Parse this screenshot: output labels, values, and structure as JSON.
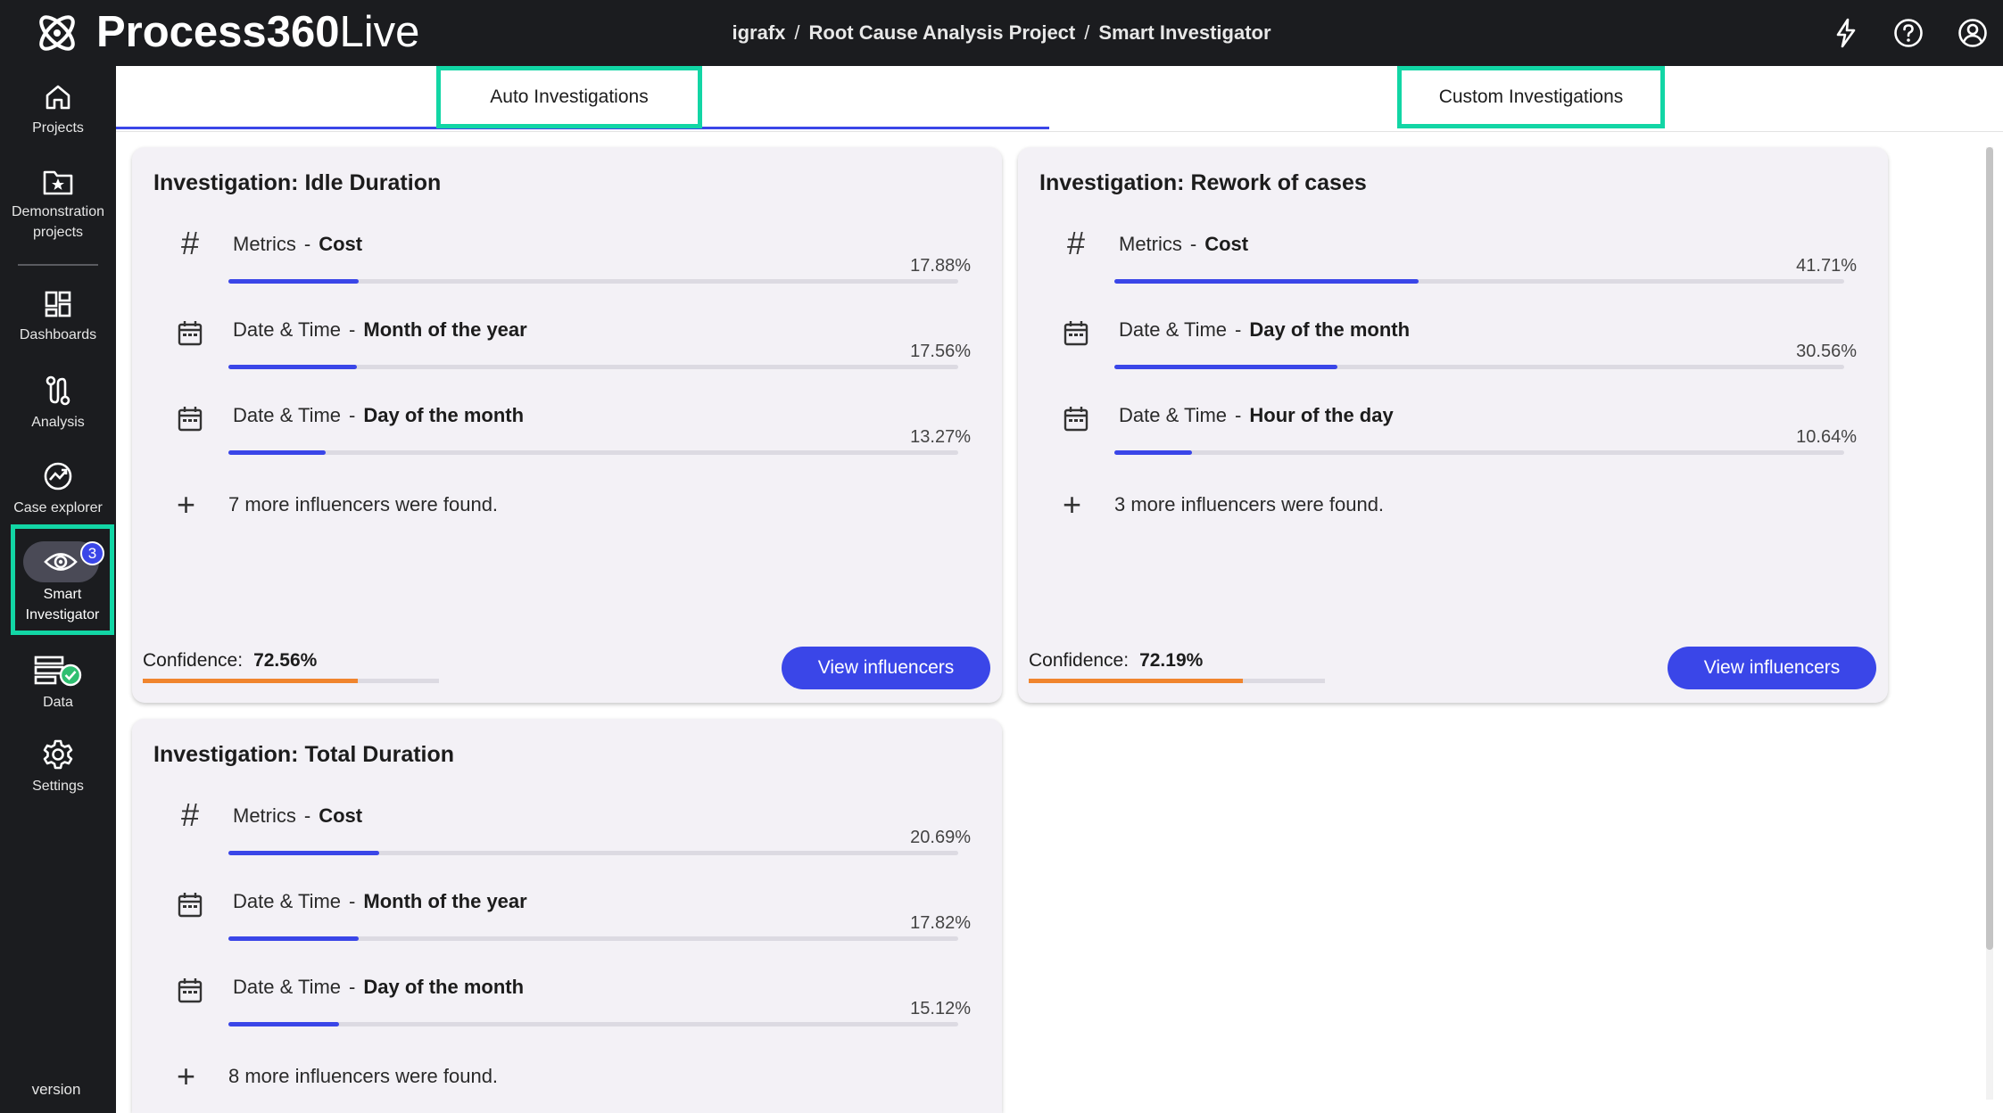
{
  "app": {
    "name_bold": "Process360",
    "name_light": "Live"
  },
  "breadcrumb": [
    "igrafx",
    "Root Cause Analysis Project",
    "Smart Investigator"
  ],
  "breadcrumb_sep": "/",
  "top_icons": [
    "lightning-icon",
    "help-icon",
    "account-icon"
  ],
  "sidebar": {
    "items": [
      {
        "id": "projects",
        "label": "Projects",
        "icon": "home-icon"
      },
      {
        "id": "demo",
        "label": "Demonstration projects",
        "icon": "folder-star-icon"
      },
      {
        "id": "dashboards",
        "label": "Dashboards",
        "icon": "dashboard-icon"
      },
      {
        "id": "analysis",
        "label": "Analysis",
        "icon": "flow-icon"
      },
      {
        "id": "case",
        "label": "Case explorer",
        "icon": "case-explorer-icon"
      },
      {
        "id": "smart",
        "label": "Smart Investigator",
        "icon": "eye-icon",
        "badge": "3",
        "active": true
      },
      {
        "id": "data",
        "label": "Data",
        "icon": "data-icon"
      },
      {
        "id": "settings",
        "label": "Settings",
        "icon": "gear-icon"
      }
    ],
    "version_label": "version"
  },
  "tabs": {
    "auto": "Auto Investigations",
    "custom": "Custom Investigations"
  },
  "colors": {
    "accent": "#3a46e8",
    "highlight": "#12d6a5",
    "confidence": "#f0852e",
    "sidebar_bg": "#1b1c1f"
  },
  "investigations": [
    {
      "title": "Investigation: Idle Duration",
      "influencers": [
        {
          "icon": "hash-icon",
          "category": "Metrics",
          "dimension": "Cost",
          "percent": "17.88%",
          "value": 17.88
        },
        {
          "icon": "calendar-icon",
          "category": "Date & Time",
          "dimension": "Month of the year",
          "percent": "17.56%",
          "value": 17.56
        },
        {
          "icon": "calendar-icon",
          "category": "Date & Time",
          "dimension": "Day of the month",
          "percent": "13.27%",
          "value": 13.27
        }
      ],
      "more_text": "7 more influencers were found.",
      "confidence_label": "Confidence:",
      "confidence": "72.56%",
      "confidence_value": 72.56,
      "button": "View influencers"
    },
    {
      "title": "Investigation: Rework of cases",
      "influencers": [
        {
          "icon": "hash-icon",
          "category": "Metrics",
          "dimension": "Cost",
          "percent": "41.71%",
          "value": 41.71
        },
        {
          "icon": "calendar-icon",
          "category": "Date & Time",
          "dimension": "Day of the month",
          "percent": "30.56%",
          "value": 30.56
        },
        {
          "icon": "calendar-icon",
          "category": "Date & Time",
          "dimension": "Hour of the day",
          "percent": "10.64%",
          "value": 10.64
        }
      ],
      "more_text": "3 more influencers were found.",
      "confidence_label": "Confidence:",
      "confidence": "72.19%",
      "confidence_value": 72.19,
      "button": "View influencers"
    },
    {
      "title": "Investigation: Total Duration",
      "influencers": [
        {
          "icon": "hash-icon",
          "category": "Metrics",
          "dimension": "Cost",
          "percent": "20.69%",
          "value": 20.69
        },
        {
          "icon": "calendar-icon",
          "category": "Date & Time",
          "dimension": "Month of the year",
          "percent": "17.82%",
          "value": 17.82
        },
        {
          "icon": "calendar-icon",
          "category": "Date & Time",
          "dimension": "Day of the month",
          "percent": "15.12%",
          "value": 15.12
        }
      ],
      "more_text": "8 more influencers were found."
    }
  ]
}
